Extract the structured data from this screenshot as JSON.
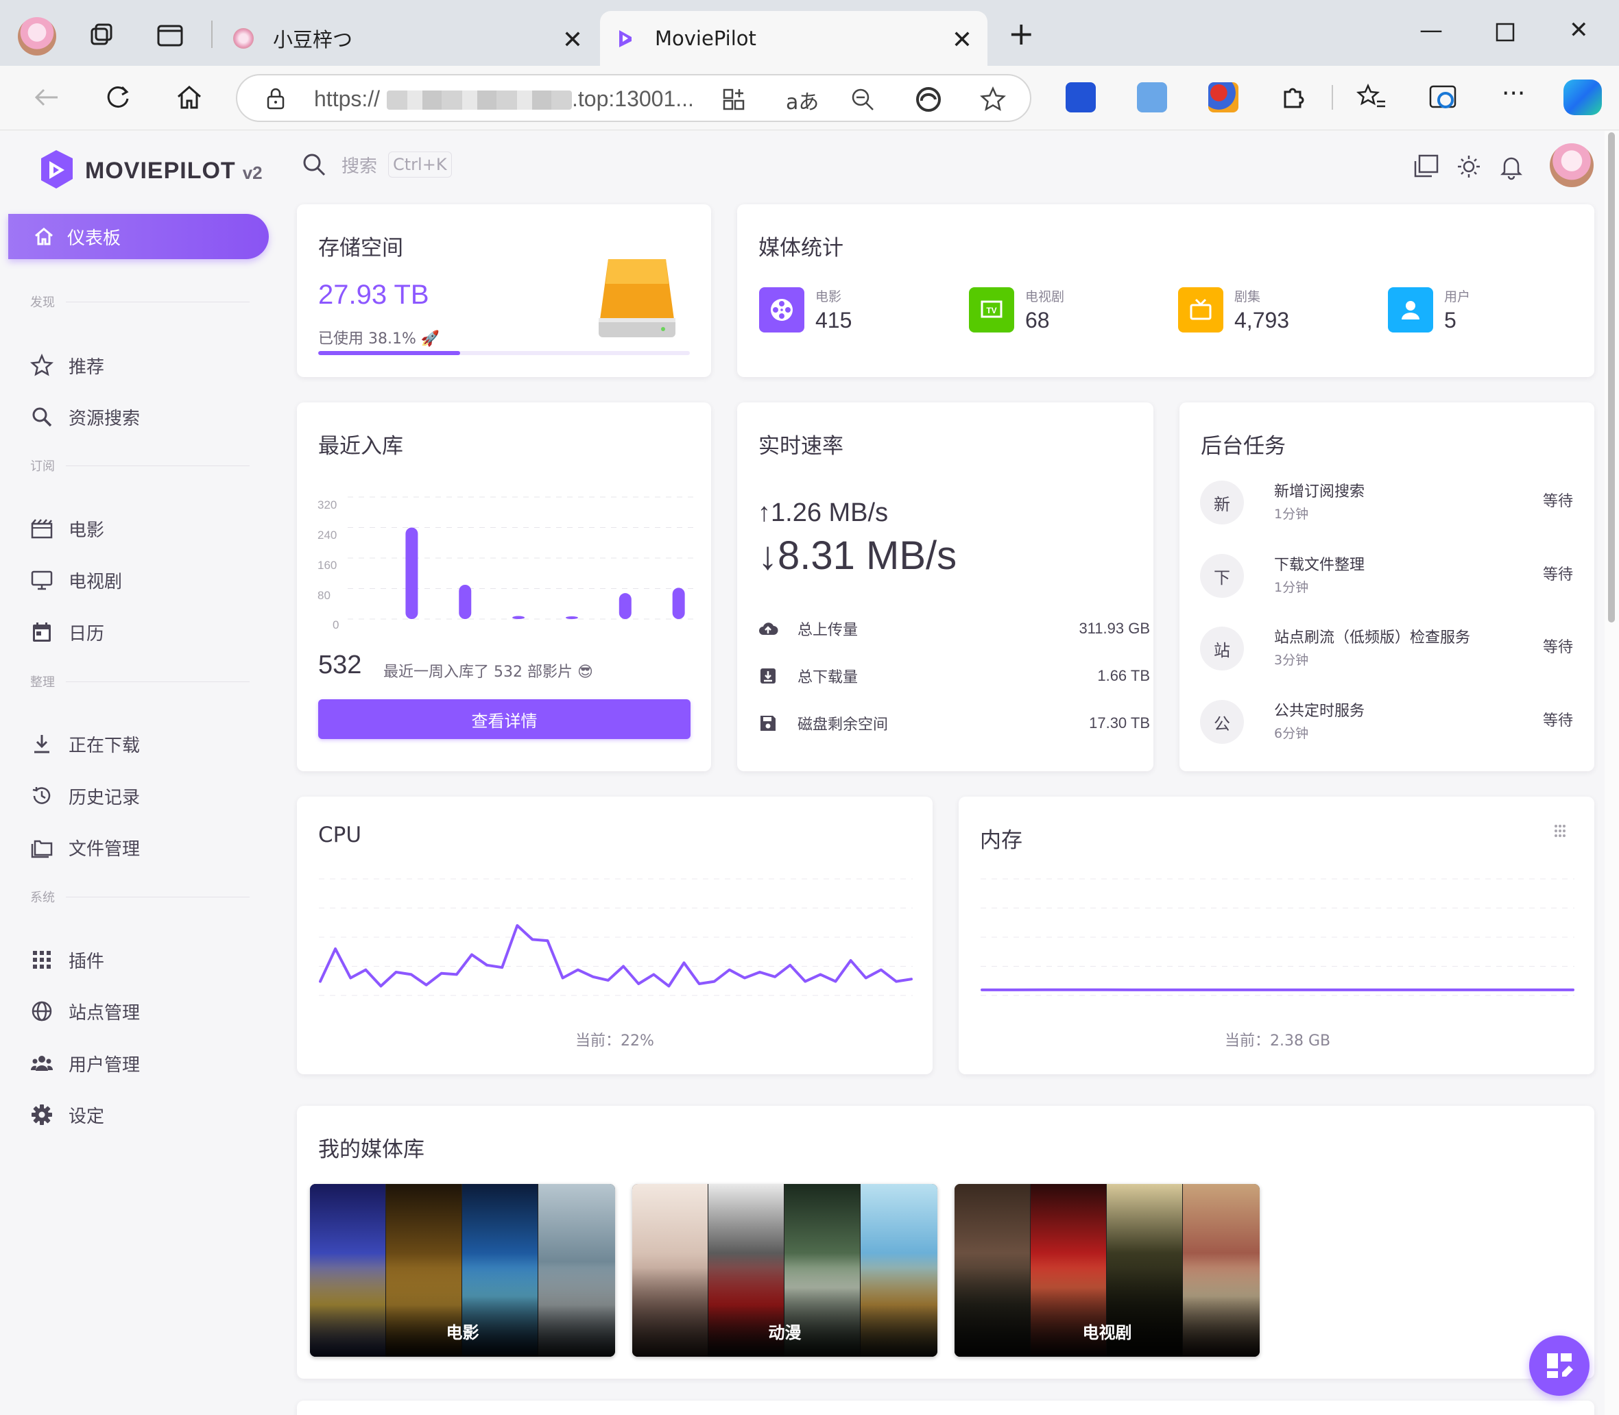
{
  "browser": {
    "tabs": [
      {
        "title": "小豆梓つ",
        "active": false
      },
      {
        "title": "MoviePilot",
        "active": true
      }
    ],
    "url": {
      "prefix": "https://",
      "suffix": ".top:13001..."
    }
  },
  "app": {
    "logo_text": "MOVIEPILOT",
    "logo_version": "v2",
    "accent": "#8c57ff",
    "search": {
      "placeholder": "搜索",
      "shortcut": "Ctrl+K"
    }
  },
  "sidebar": {
    "active_item": {
      "label": "仪表板",
      "icon": "home-icon"
    },
    "sections": [
      {
        "label": "发现",
        "items": [
          {
            "label": "推荐",
            "icon": "star-icon"
          },
          {
            "label": "资源搜索",
            "icon": "search-icon"
          }
        ]
      },
      {
        "label": "订阅",
        "items": [
          {
            "label": "电影",
            "icon": "movie-icon"
          },
          {
            "label": "电视剧",
            "icon": "monitor-icon"
          },
          {
            "label": "日历",
            "icon": "calendar-icon"
          }
        ]
      },
      {
        "label": "整理",
        "items": [
          {
            "label": "正在下载",
            "icon": "download-icon"
          },
          {
            "label": "历史记录",
            "icon": "history-icon"
          },
          {
            "label": "文件管理",
            "icon": "folder-icon"
          }
        ]
      },
      {
        "label": "系统",
        "items": [
          {
            "label": "插件",
            "icon": "grid-icon"
          },
          {
            "label": "站点管理",
            "icon": "globe-icon"
          },
          {
            "label": "用户管理",
            "icon": "users-icon"
          },
          {
            "label": "设定",
            "icon": "gear-icon"
          }
        ]
      }
    ]
  },
  "storage": {
    "title": "存储空间",
    "value": "27.93 TB",
    "used_label": "已使用 38.1%",
    "used_fraction": 0.381
  },
  "media_stats": {
    "title": "媒体统计",
    "items": [
      {
        "label": "电影",
        "value": "415",
        "color": "#8c57ff",
        "icon": "film-reel-icon"
      },
      {
        "label": "电视剧",
        "value": "68",
        "color": "#56ca00",
        "icon": "tv-icon"
      },
      {
        "label": "剧集",
        "value": "4,793",
        "color": "#ffb400",
        "icon": "retro-tv-icon"
      },
      {
        "label": "用户",
        "value": "5",
        "color": "#16b1ff",
        "icon": "user-icon"
      }
    ]
  },
  "recent": {
    "title": "最近入库",
    "total": "532",
    "description": "最近一周入库了 532 部影片 😎",
    "button": "查看详情"
  },
  "speed": {
    "title": "实时速率",
    "up": "↑1.26 MB/s",
    "down": "↓8.31 MB/s",
    "rows": [
      {
        "label": "总上传量",
        "value": "311.93 GB",
        "icon": "cloud-upload-icon"
      },
      {
        "label": "总下载量",
        "value": "1.66 TB",
        "icon": "download-box-icon"
      },
      {
        "label": "磁盘剩余空间",
        "value": "17.30 TB",
        "icon": "floppy-icon"
      }
    ]
  },
  "tasks": {
    "title": "后台任务",
    "items": [
      {
        "avatar": "新",
        "name": "新增订阅搜索",
        "time": "1分钟",
        "status": "等待"
      },
      {
        "avatar": "下",
        "name": "下载文件整理",
        "time": "1分钟",
        "status": "等待"
      },
      {
        "avatar": "站",
        "name": "站点刷流（低频版）检查服务",
        "time": "3分钟",
        "status": "等待"
      },
      {
        "avatar": "公",
        "name": "公共定时服务",
        "time": "6分钟",
        "status": "等待"
      }
    ]
  },
  "cpu": {
    "title": "CPU",
    "current": "当前：22%"
  },
  "memory": {
    "title": "内存",
    "current": "当前：2.38 GB"
  },
  "library": {
    "title": "我的媒体库",
    "items": [
      {
        "label": "电影"
      },
      {
        "label": "动漫"
      },
      {
        "label": "电视剧"
      }
    ]
  },
  "chart_data": [
    {
      "type": "bar",
      "ylim": [
        0,
        320
      ],
      "yticks": [
        "320",
        "240",
        "160",
        "80",
        "0"
      ],
      "values": [
        240,
        90,
        8,
        2,
        68,
        82
      ]
    },
    {
      "type": "line",
      "values": [
        12,
        40,
        15,
        22,
        8,
        20,
        18,
        9,
        19,
        18,
        35,
        26,
        24,
        60,
        48,
        47,
        15,
        22,
        16,
        13,
        25,
        10,
        18,
        8,
        28,
        10,
        12,
        22,
        15,
        20,
        16,
        26,
        12,
        18,
        12,
        30,
        15,
        22,
        12,
        14
      ],
      "ylim": [
        0,
        100
      ]
    },
    {
      "type": "line",
      "values": [
        2.38,
        2.38,
        2.4,
        2.41,
        2.41,
        2.39,
        2.38,
        2.38,
        2.38,
        2.38,
        2.38,
        2.38,
        2.38,
        2.38,
        2.38,
        2.38,
        2.38,
        2.38,
        2.38,
        2.38
      ],
      "ylim": [
        0,
        50
      ]
    }
  ]
}
